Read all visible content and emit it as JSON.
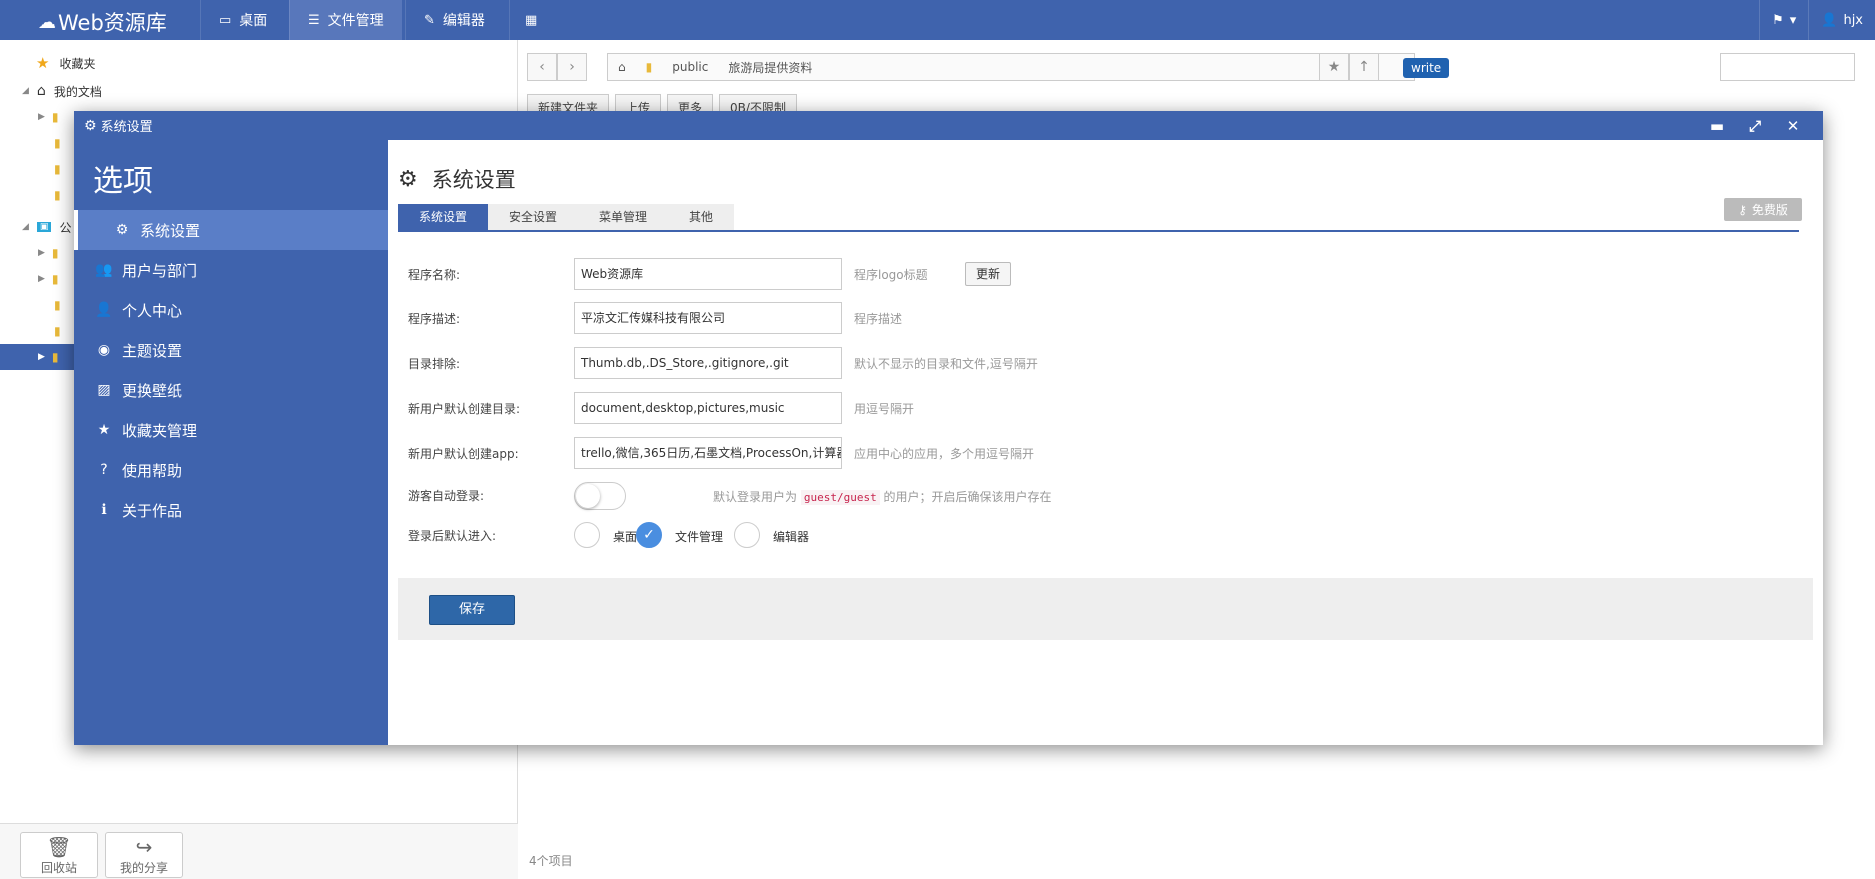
{
  "app": {
    "name": "Web资源库"
  },
  "topnav": {
    "items": [
      {
        "label": "桌面"
      },
      {
        "label": "文件管理"
      },
      {
        "label": "编辑器"
      }
    ],
    "user": "hjx"
  },
  "sidebar": {
    "favorites": "收藏夹",
    "my_docs": "我的文档",
    "public_prefix": "公",
    "recycle_bin": "回收站",
    "my_share": "我的分享"
  },
  "main": {
    "path": [
      "public",
      "旅游局提供资料"
    ],
    "write_badge": "write",
    "toolbar": {
      "new_folder": "新建文件夹",
      "upload": "上传",
      "more": "更多",
      "quota": "0B/不限制"
    },
    "status": "4个项目"
  },
  "modal": {
    "window_title": "系统设置",
    "side_title": "选项",
    "menu": [
      {
        "label": "系统设置"
      },
      {
        "label": "用户与部门"
      },
      {
        "label": "个人中心"
      },
      {
        "label": "主题设置"
      },
      {
        "label": "更换壁纸"
      },
      {
        "label": "收藏夹管理"
      },
      {
        "label": "使用帮助"
      },
      {
        "label": "关于作品"
      }
    ],
    "content_title": "系统设置",
    "tabs": [
      {
        "label": "系统设置"
      },
      {
        "label": "安全设置"
      },
      {
        "label": "菜单管理"
      },
      {
        "label": "其他"
      }
    ],
    "free_badge": "免费版",
    "form": {
      "name": {
        "label": "程序名称:",
        "value": "Web资源库",
        "hint": "程序logo标题",
        "button": "更新"
      },
      "desc": {
        "label": "程序描述:",
        "value": "平凉文汇传媒科技有限公司",
        "hint": "程序描述"
      },
      "exclude": {
        "label": "目录排除:",
        "value": "Thumb.db,.DS_Store,.gitignore,.git",
        "hint": "默认不显示的目录和文件,逗号隔开"
      },
      "default_dirs": {
        "label": "新用户默认创建目录:",
        "value": "document,desktop,pictures,music",
        "hint": "用逗号隔开"
      },
      "default_apps": {
        "label": "新用户默认创建app:",
        "value": "trello,微信,365日历,石墨文档,ProcessOn,计算器,",
        "hint": "应用中心的应用，多个用逗号隔开"
      },
      "guest": {
        "label": "游客自动登录:",
        "hint_pre": "默认登录用户为",
        "hint_code": "guest/guest",
        "hint_post": "的用户；开启后确保该用户存在"
      },
      "landing": {
        "label": "登录后默认进入:",
        "options": [
          "桌面",
          "文件管理",
          "编辑器"
        ]
      }
    },
    "save": "保存"
  }
}
